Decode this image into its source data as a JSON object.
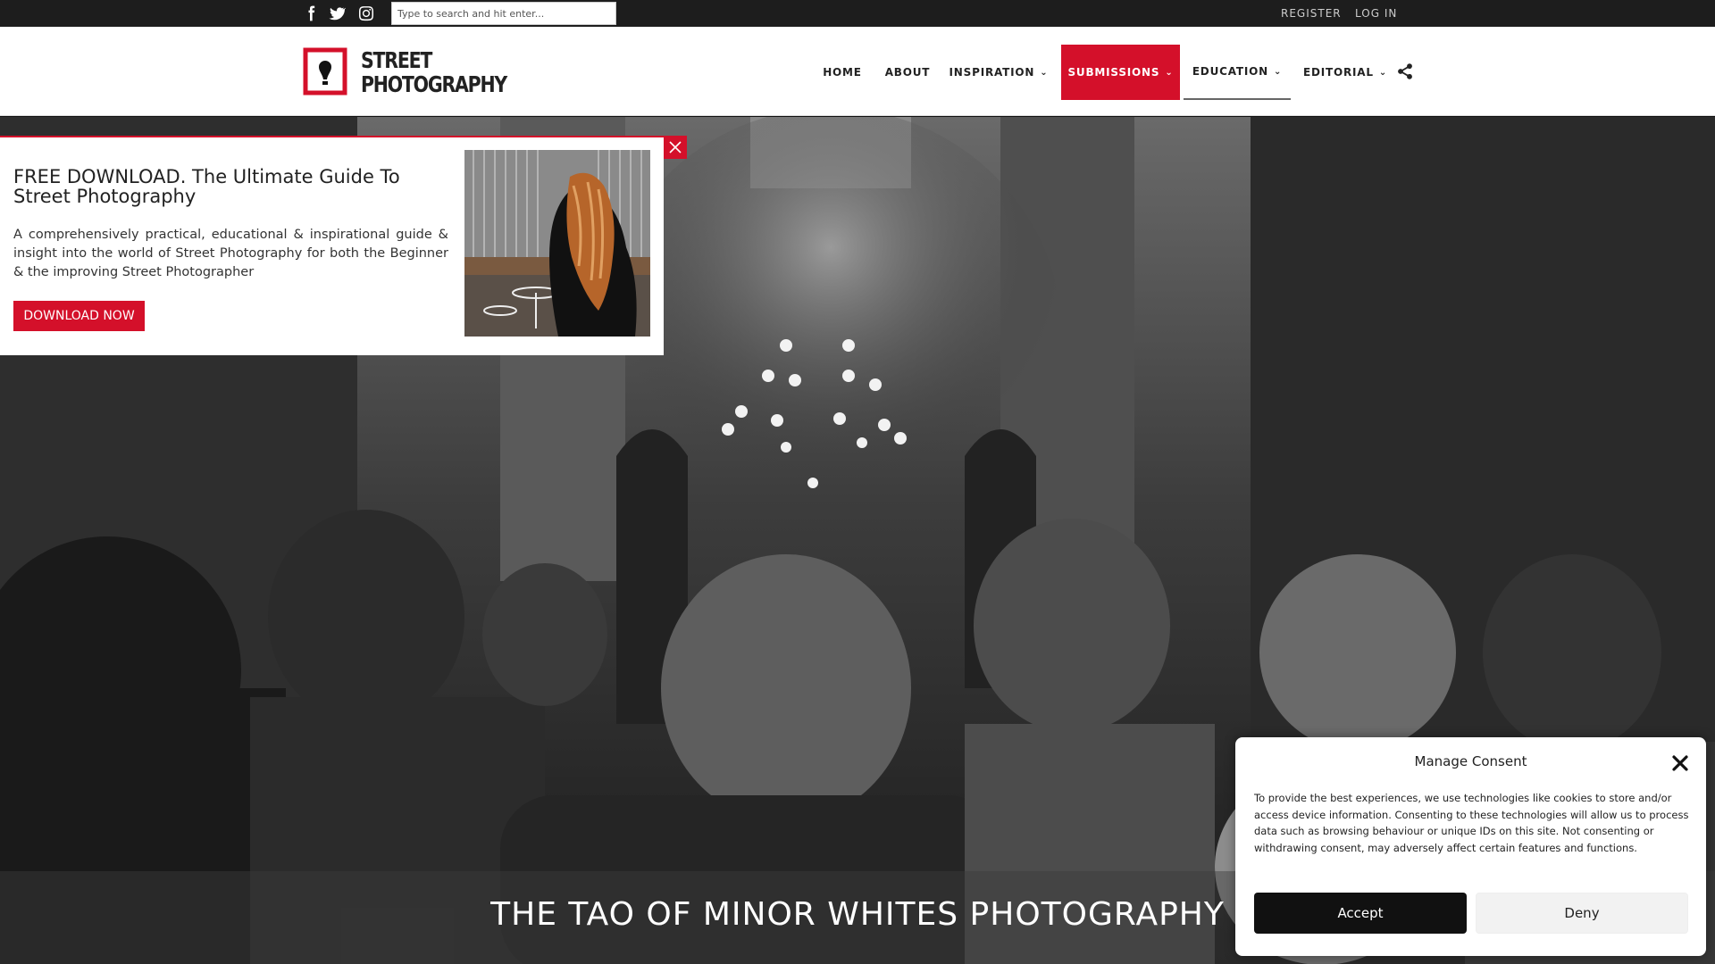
{
  "topbar": {
    "social": [
      {
        "name": "facebook-icon"
      },
      {
        "name": "twitter-icon"
      },
      {
        "name": "instagram-icon"
      }
    ],
    "search_placeholder": "Type to search and hit enter...",
    "register_label": "REGISTER",
    "login_label": "LOG IN"
  },
  "header": {
    "logo_line1": "STREET",
    "logo_line2": "PHOTOGRAPHY",
    "nav": [
      {
        "label": "HOME",
        "has_dropdown": false
      },
      {
        "label": "ABOUT",
        "has_dropdown": false
      },
      {
        "label": "INSPIRATION",
        "has_dropdown": true
      },
      {
        "label": "SUBMISSIONS",
        "has_dropdown": true,
        "active": true
      },
      {
        "label": "EDUCATION",
        "has_dropdown": true
      },
      {
        "label": "EDITORIAL",
        "has_dropdown": true
      }
    ],
    "share_icon": "share-icon"
  },
  "hero": {
    "title": "THE TAO OF MINOR WHITES PHOTOGRAPHY"
  },
  "popup": {
    "title": "FREE DOWNLOAD. The Ultimate Guide To Street Photography",
    "description": "A comprehensively practical, educational & inspirational guide & insight into the world of Street Photography for both the Beginner & the improving Street Photographer",
    "button_label": "DOWNLOAD NOW"
  },
  "consent": {
    "title": "Manage Consent",
    "text": "To provide the best experiences, we use technologies like cookies to store and/or access device information. Consenting to these technologies will allow us to process data such as browsing behaviour or unique IDs on this site. Not consenting or withdrawing consent, may adversely affect certain features and functions.",
    "accept_label": "Accept",
    "deny_label": "Deny"
  },
  "colors": {
    "brand_red": "#d4102a",
    "topbar_bg": "#1d1d1d"
  }
}
